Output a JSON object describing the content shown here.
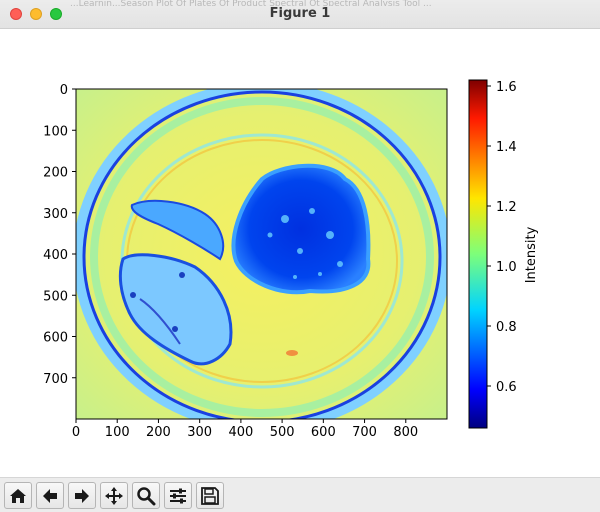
{
  "window": {
    "title": "Figure 1",
    "background_title_text": "...Learnin...Season   Plot   Of Plates   Of Product   Spectral   Ot Spectral   Analysis Tool   ..."
  },
  "toolbar": {
    "items": [
      {
        "name": "home-button",
        "icon": "home-icon"
      },
      {
        "name": "back-button",
        "icon": "arrow-left-icon"
      },
      {
        "name": "forward-button",
        "icon": "arrow-right-icon"
      },
      {
        "name": "pan-button",
        "icon": "move-icon"
      },
      {
        "name": "zoom-button",
        "icon": "magnifier-icon"
      },
      {
        "name": "configure-subplots-button",
        "icon": "sliders-icon"
      },
      {
        "name": "save-button",
        "icon": "floppy-disk-icon"
      }
    ]
  },
  "chart_data": {
    "type": "heatmap",
    "title": "",
    "xlabel": "",
    "ylabel": "",
    "xlim": [
      0,
      900
    ],
    "ylim": [
      800,
      0
    ],
    "x_ticks": [
      "0",
      "100",
      "200",
      "300",
      "400",
      "500",
      "600",
      "700",
      "800"
    ],
    "y_ticks": [
      "0",
      "100",
      "200",
      "300",
      "400",
      "500",
      "600",
      "700"
    ],
    "colorbar": {
      "label": "Intensity",
      "min": 0.46,
      "max": 1.62,
      "ticks": [
        "0.6",
        "0.8",
        "1.0",
        "1.2",
        "1.4",
        "1.6"
      ],
      "colormap": "jet"
    },
    "description_values": {
      "background_intensity": 1.1,
      "right_food_region_intensity": 0.55,
      "left_food_region_intensity": 0.8,
      "plate_rim_intensity": 0.6
    }
  }
}
